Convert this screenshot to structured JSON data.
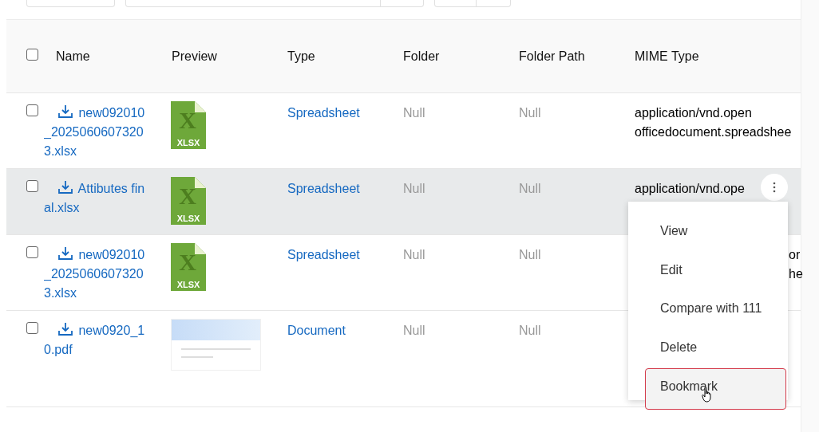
{
  "table": {
    "columns": [
      "Name",
      "Preview",
      "Type",
      "Folder",
      "Folder Path",
      "MIME Type"
    ],
    "header_checkbox": {
      "checked": false
    },
    "rows": [
      {
        "name": "new092010_20250606073203.xlsx",
        "kind": "spreadsheet",
        "preview_glyph": "X",
        "preview_label": "XLSX",
        "type": "Spreadsheet",
        "folder": "Null",
        "folder_path": "Null",
        "mime_type": [
          "application/vnd.open",
          "officedocument.spreadshee"
        ],
        "checked": false,
        "highlighted": false,
        "menu_open": false
      },
      {
        "name": "Attibutes final.xlsx",
        "kind": "spreadsheet",
        "preview_glyph": "X",
        "preview_label": "XLSX",
        "type": "Spreadsheet",
        "folder": "Null",
        "folder_path": "Null",
        "mime_type": [
          "application/vnd.ope"
        ],
        "checked": false,
        "highlighted": true,
        "menu_open": true
      },
      {
        "name": "new092010_20250606073203.xlsx",
        "kind": "spreadsheet",
        "preview_glyph": "X",
        "preview_label": "XLSX",
        "type": "Spreadsheet",
        "folder": "Null",
        "folder_path": "Null",
        "mime_type": [
          "or",
          "he"
        ],
        "checked": false,
        "highlighted": false,
        "menu_open": false
      },
      {
        "name": "new0920_10.pdf",
        "kind": "document",
        "type": "Document",
        "folder": "Null",
        "folder_path": "Null",
        "checked": false,
        "highlighted": false,
        "menu_open": false
      }
    ]
  },
  "row_menu": {
    "items": [
      {
        "label": "View",
        "hovered": false
      },
      {
        "label": "Edit",
        "hovered": false
      },
      {
        "label": "Compare with 111",
        "hovered": false
      },
      {
        "label": "Delete",
        "hovered": false
      },
      {
        "label": "Bookmark",
        "hovered": true
      }
    ]
  }
}
